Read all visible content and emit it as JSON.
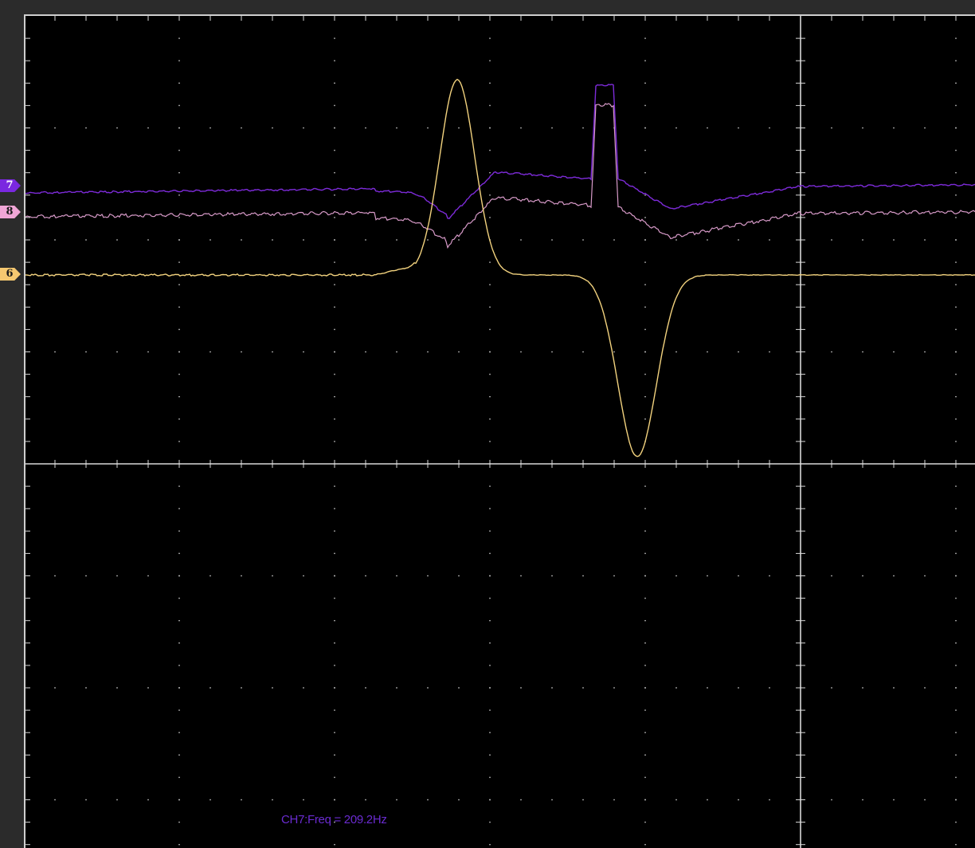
{
  "channels": [
    {
      "id": "ch7",
      "label": "7",
      "color": "#7d2bd9",
      "marker_color": "#7a28e0",
      "text_color": "#ffffff"
    },
    {
      "id": "ch8",
      "label": "8",
      "color": "#d79ac8",
      "marker_color": "#f0a6d6",
      "text_color": "#1a1a1a"
    },
    {
      "id": "ch6",
      "label": "6",
      "color": "#f2d27e",
      "marker_color": "#f5c870",
      "text_color": "#1a1a1a"
    }
  ],
  "measurement": {
    "text": "CH7:Freq = 209.2Hz",
    "color": "#6a2bd0"
  },
  "colors": {
    "background": "#000000",
    "frame": "#2b2b2b",
    "grid": "#d8d8d8"
  }
}
